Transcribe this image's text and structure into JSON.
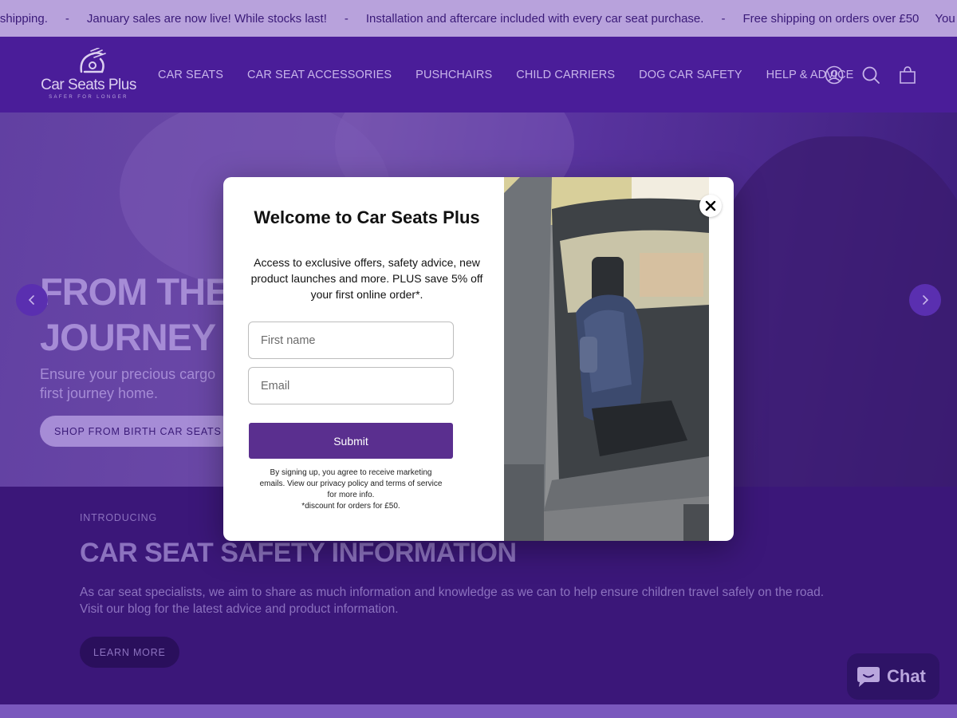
{
  "announcement": {
    "items": [
      "ee shipping.",
      "January sales are now live! While stocks last!",
      "Installation and aftercare included with every car seat purchase.",
      "Free shipping on orders over £50",
      "You are"
    ],
    "separator": "-"
  },
  "header": {
    "logo_text": "Car Seats Plus",
    "logo_tagline": "SAFER FOR LONGER",
    "nav": [
      "CAR SEATS",
      "CAR SEAT ACCESSORIES",
      "PUSHCHAIRS",
      "CHILD CARRIERS",
      "DOG CAR SAFETY",
      "HELP & ADVICE"
    ],
    "icons": [
      "account-icon",
      "search-icon",
      "cart-icon"
    ]
  },
  "hero": {
    "title_line1": "FROM THE",
    "title_line2": "JOURNEY H",
    "subtitle_line1": "Ensure your precious cargo",
    "subtitle_line2": "first journey home.",
    "button": "SHOP FROM BIRTH CAR SEATS"
  },
  "safety": {
    "eyebrow": "INTRODUCING",
    "title": "CAR SEAT SAFETY INFORMATION",
    "body_line1": "As car seat specialists, we aim to share as much information and knowledge as we can to help ensure children travel safely on the road.",
    "body_line2": "Visit our blog for the latest advice and product information.",
    "button": "LEARN MORE"
  },
  "modal": {
    "title": "Welcome to Car Seats Plus",
    "description": "Access to exclusive offers, safety advice, new product launches and more. PLUS save 5% off your first online order*.",
    "first_name_placeholder": "First name",
    "email_placeholder": "Email",
    "submit": "Submit",
    "fine_line1": "By signing up, you agree to receive marketing",
    "fine_line2": "emails. View our privacy policy and terms of service",
    "fine_line3": "for more info.",
    "fine_line4": "*discount for orders for £50."
  },
  "chat": {
    "label": "Chat"
  },
  "colors": {
    "announcement_bg": "#b8a2dc",
    "header_bg": "#4a1d99",
    "accent": "#5a2f8f",
    "section_bg": "#3b1779"
  }
}
